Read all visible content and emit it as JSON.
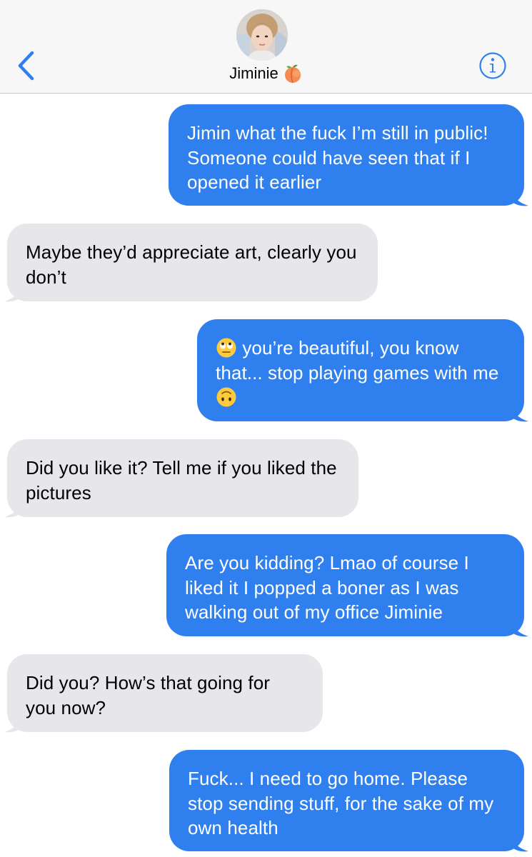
{
  "header": {
    "contact_name": "Jiminie",
    "name_emoji": "peach-icon",
    "accent_color": "#2f80ee"
  },
  "messages": [
    {
      "side": "sent",
      "text": "Jimin what the fuck I’m still in public! Someone could have seen that if I opened it earlier"
    },
    {
      "side": "received",
      "text": "Maybe they’d appreciate art, clearly you don’t"
    },
    {
      "side": "sent",
      "text_part1": "you’re beautiful, you know that... stop playing games with me",
      "emoji_start": "eye-roll-emoji",
      "emoji_end": "upside-down-face-emoji"
    },
    {
      "side": "received",
      "text": "Did you like it? Tell me if you liked the pictures"
    },
    {
      "side": "sent",
      "text": "Are you kidding? Lmao of course I liked it I popped a boner as I was walking out of my office Jiminie"
    },
    {
      "side": "received",
      "text": "Did you? How’s that going for you now?"
    },
    {
      "side": "sent",
      "text": "Fuck... I need to go home. Please stop sending stuff, for the sake of my own health"
    }
  ],
  "colors": {
    "sent_bubble": "#2f80ee",
    "received_bubble": "#e6e6eb",
    "header_bg": "#f7f7f8"
  }
}
